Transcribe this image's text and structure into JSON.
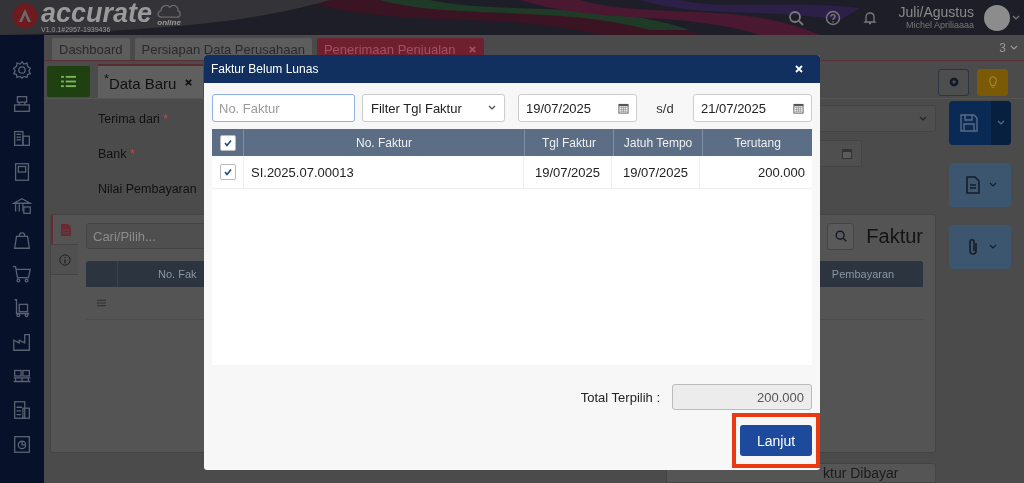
{
  "app": {
    "logo": "accurate",
    "logo_sub": "online",
    "version": "V1.0.1#2957-1939436",
    "period": "Juli/Agustus",
    "user": "Michel Apriliaaaa"
  },
  "tabs": [
    {
      "label": "Dashboard",
      "selected": false,
      "closable": false
    },
    {
      "label": "Persiapan Data Perusahaan",
      "selected": false,
      "closable": false
    },
    {
      "label": "Penerimaan Penjualan",
      "selected": true,
      "closable": true
    }
  ],
  "tab_count": "3",
  "sub_tab": {
    "label": "$^{*}$Data Baru"
  },
  "form": {
    "fields": [
      {
        "label": "Terima dari",
        "marker": "*",
        "kind": "select"
      },
      {
        "label": "Bank",
        "marker": "*",
        "kind": "date"
      },
      {
        "label": "Nilai Pembayaran",
        "kind": "text"
      }
    ]
  },
  "detail": {
    "search_placeholder": "Cari/Pilih...",
    "columns": [
      "No. Fak",
      "Pembayaran"
    ],
    "title": "Faktur",
    "footer_label": "ktur Dibayar"
  },
  "dialog": {
    "title": "Faktur Belum Lunas",
    "search_placeholder": "No. Faktur",
    "filter": "Filter Tgl Faktur",
    "date_from": "19/07/2025",
    "separator": "s/d",
    "date_to": "21/07/2025",
    "select_all": true,
    "columns": [
      "No. Faktur",
      "Tgl Faktur",
      "Jatuh Tempo",
      "Terutang"
    ],
    "rows": [
      {
        "no": "SI.2025.07.00013",
        "tgl": "19/07/2025",
        "jatuh_tempo": "19/07/2025",
        "terutang": "200.000",
        "checked": true
      }
    ],
    "total_label": "Total Terpilih :",
    "total_value": "200.000",
    "button": "Lanjut"
  }
}
